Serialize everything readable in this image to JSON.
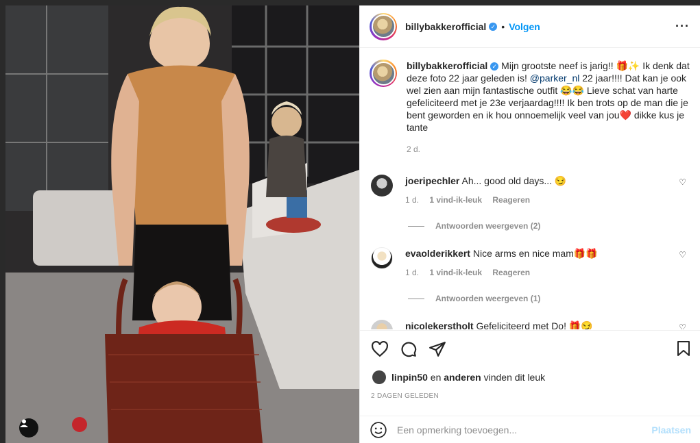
{
  "post": {
    "username": "billybakkerofficial",
    "verified_icon": "verified-badge-icon",
    "separator": "•",
    "follow_label": "Volgen",
    "more_label": "···",
    "caption_before_mention": "Mijn grootste neef is jarig!! 🎁✨ Ik denk dat deze foto 22 jaar geleden is! ",
    "mention": "@parker_nl",
    "caption_after_mention": " 22 jaar!!!! Dat kan je ook wel zien aan mijn fantastische outfit 😂😂 Lieve schat van harte gefeliciteerd met je 23e verjaardag!!!! Ik ben trots op de man die je bent geworden en ik hou onnoemelijk veel van jou❤️ dikke kus je tante",
    "caption_age": "2 d."
  },
  "comments": [
    {
      "username": "joeripechler",
      "text": "Ah... good old days... 😏",
      "age": "1 d.",
      "likes": "1 vind-ik-leuk",
      "reply_label": "Reageren",
      "view_replies": "Antwoorden weergeven (2)"
    },
    {
      "username": "evaolderikkert",
      "text": "Nice arms en nice mam🎁🎁",
      "age": "1 d.",
      "likes": "1 vind-ik-leuk",
      "reply_label": "Reageren",
      "view_replies": "Antwoorden weergeven (1)"
    },
    {
      "username": "nicolekerstholt",
      "text": "Gefeliciteerd met Do! 🎁😏"
    }
  ],
  "likes": {
    "first_user": "linpin50",
    "connector": "en",
    "others": "anderen",
    "suffix": "vinden dit leuk"
  },
  "date_label": "2 DAGEN GELEDEN",
  "compose": {
    "placeholder": "Een opmerking toevoegen...",
    "post_label": "Plaatsen"
  }
}
